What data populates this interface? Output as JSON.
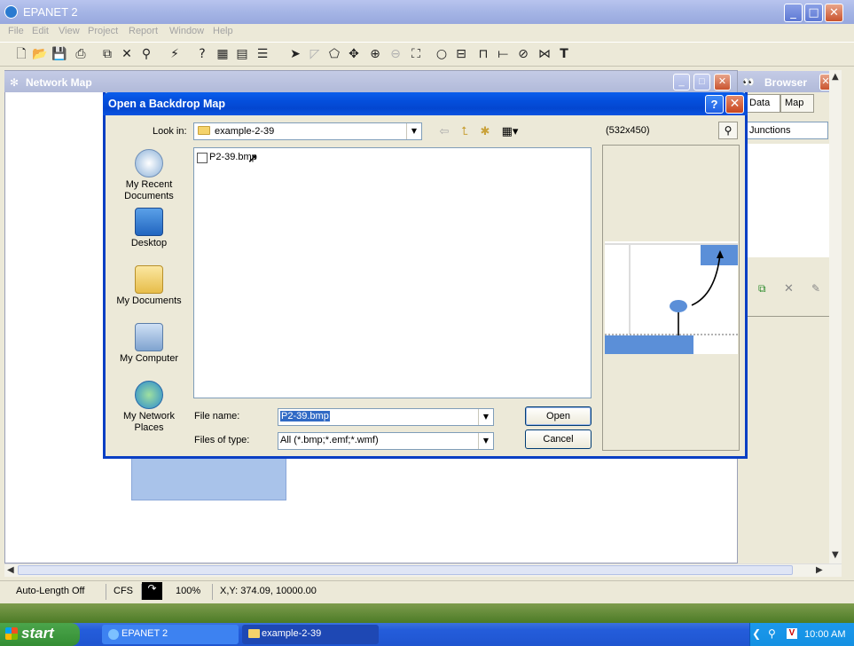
{
  "app": {
    "title": "EPANET 2",
    "menu": [
      "File",
      "Edit",
      "View",
      "Project",
      "Report",
      "Window",
      "Help"
    ]
  },
  "network_map": {
    "title": "Network Map"
  },
  "browser": {
    "title": "Browser",
    "tabs": [
      "Data",
      "Map"
    ],
    "category": "Junctions"
  },
  "status_bar": {
    "auto_length": "Auto-Length Off",
    "flow_units": "CFS",
    "zoom": "100%",
    "coordinates": "X,Y: 374.09, 10000.00"
  },
  "dialog": {
    "title": "Open a Backdrop Map",
    "look_in_label": "Look in:",
    "look_in_value": "example-2-39",
    "places": [
      "My Recent Documents",
      "Desktop",
      "My Documents",
      "My Computer",
      "My Network Places"
    ],
    "files": [
      "P2-39.bmp"
    ],
    "file_name_label": "File name:",
    "file_name_value": "P2-39.bmp",
    "files_of_type_label": "Files of type:",
    "files_of_type_value": "All (*.bmp;*.emf;*.wmf)",
    "open_label": "Open",
    "cancel_label": "Cancel",
    "preview_size": "(532x450)"
  },
  "taskbar": {
    "start_label": "start",
    "tasks": [
      "EPANET 2",
      "example-2-39"
    ],
    "clock": "10:00 AM"
  }
}
